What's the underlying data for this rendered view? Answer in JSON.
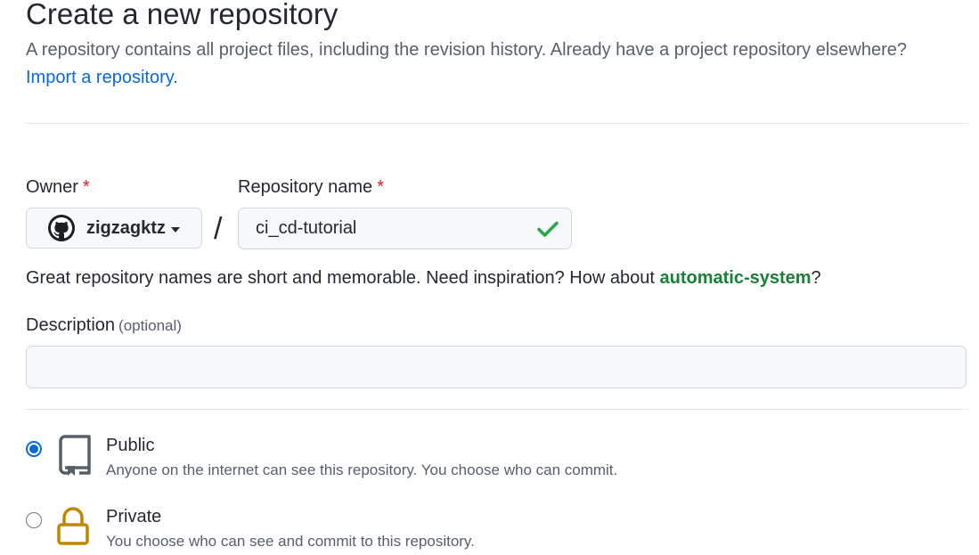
{
  "header": {
    "title": "Create a new repository",
    "subtitle": "A repository contains all project files, including the revision history. Already have a project repository elsewhere?",
    "import_link": "Import a repository."
  },
  "owner": {
    "label": "Owner",
    "required_mark": "*",
    "value": "zigzagktz",
    "avatar_icon": "github-octocat-icon"
  },
  "separator": "/",
  "repository_name": {
    "label": "Repository name",
    "required_mark": "*",
    "value": "ci_cd-tutorial",
    "status_icon": "check-icon",
    "status_color": "#2da44e"
  },
  "name_hint": {
    "text": "Great repository names are short and memorable. Need inspiration? How about ",
    "suggestion": "automatic-system",
    "suffix": "?"
  },
  "description": {
    "label": "Description",
    "optional_label": "(optional)",
    "value": "",
    "placeholder": ""
  },
  "visibility": {
    "options": [
      {
        "id": "public",
        "title": "Public",
        "description": "Anyone on the internet can see this repository. You choose who can commit.",
        "icon": "repo-book-icon",
        "selected": true
      },
      {
        "id": "private",
        "title": "Private",
        "description": "You choose who can see and commit to this repository.",
        "icon": "lock-icon",
        "icon_color": "#bf8700",
        "selected": false
      }
    ]
  },
  "colors": {
    "link": "#0969da",
    "required": "#cf222e",
    "success": "#1a7f37",
    "radio_selected": "#0969da"
  }
}
